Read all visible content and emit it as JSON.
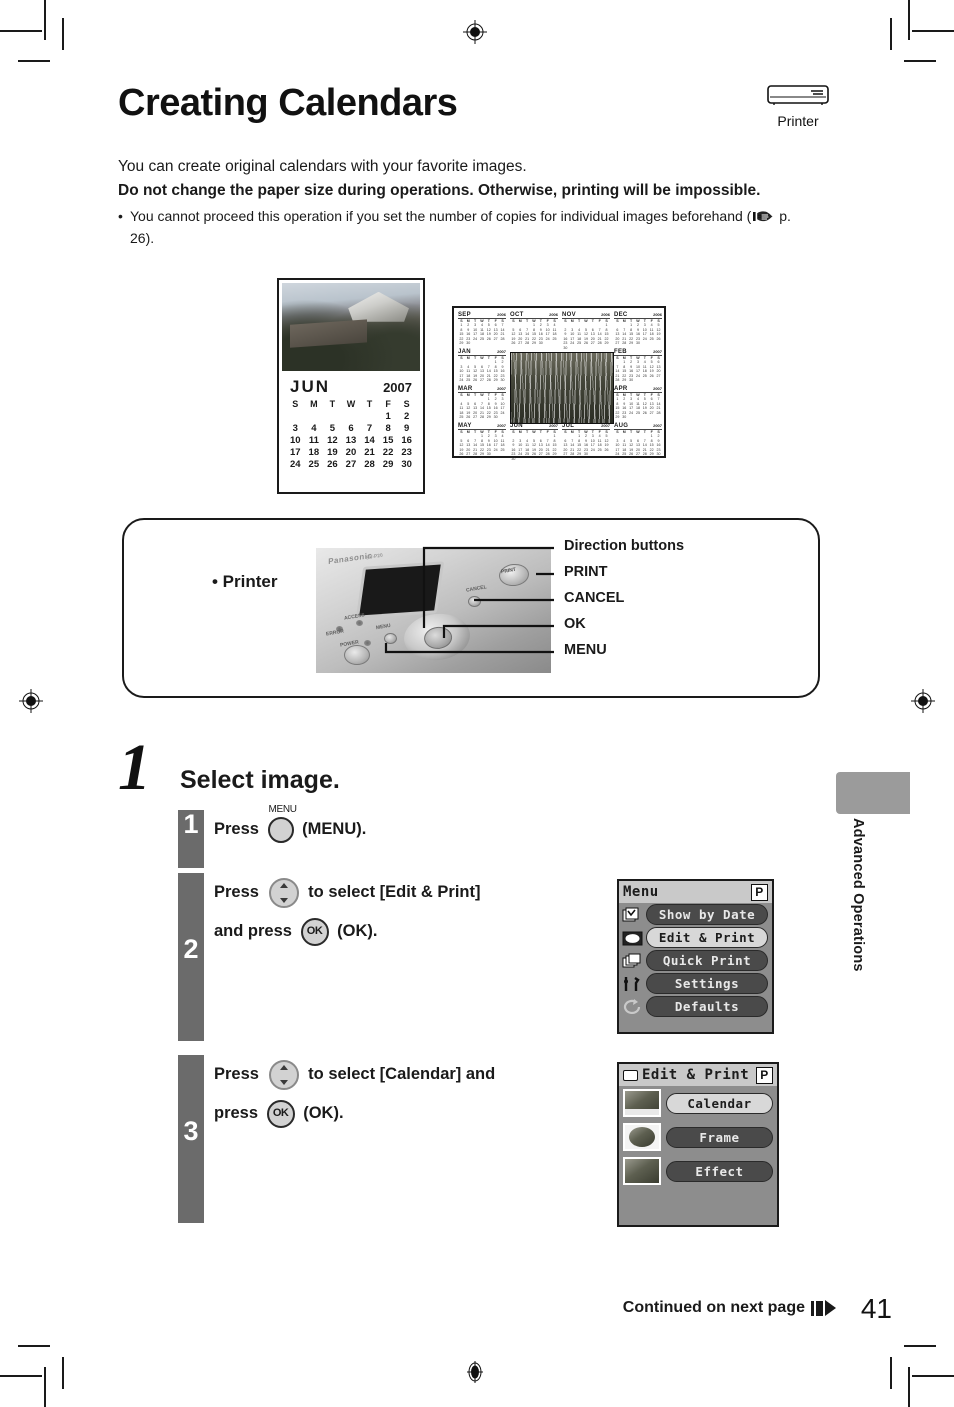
{
  "header": {
    "title": "Creating Calendars",
    "device_badge": {
      "icon": "printer-icon",
      "label": "Printer"
    }
  },
  "intro": {
    "line1": "You can create original calendars with your favorite images.",
    "warning": "Do not change the paper size during operations. Otherwise, printing will be impossible.",
    "bullet_mark": "•",
    "bullet_text_before": "You cannot proceed this operation if you set the number of copies for individual images beforehand (",
    "bullet_ref_icon": "pointing-hand-icon",
    "bullet_ref": " p. 26).",
    "bullet_text_after": ""
  },
  "samples": {
    "month_calendar": {
      "month": "JUN",
      "year": "2007",
      "dow": [
        "S",
        "M",
        "T",
        "W",
        "T",
        "F",
        "S"
      ],
      "weeks": [
        [
          "",
          "",
          "",
          "",
          "",
          "1",
          "2"
        ],
        [
          "3",
          "4",
          "5",
          "6",
          "7",
          "8",
          "9"
        ],
        [
          "10",
          "11",
          "12",
          "13",
          "14",
          "15",
          "16"
        ],
        [
          "17",
          "18",
          "19",
          "20",
          "21",
          "22",
          "23"
        ],
        [
          "24",
          "25",
          "26",
          "27",
          "28",
          "29",
          "30"
        ]
      ]
    },
    "year_calendar": {
      "months": [
        {
          "name": "SEP",
          "year": "2006"
        },
        {
          "name": "OCT",
          "year": "2006"
        },
        {
          "name": "NOV",
          "year": "2006"
        },
        {
          "name": "DEC",
          "year": "2006"
        },
        {
          "name": "JAN",
          "year": "2007"
        },
        {
          "name": "FEB",
          "year": "2007"
        },
        {
          "name": "MAR",
          "year": "2007"
        },
        {
          "name": "APR",
          "year": "2007"
        },
        {
          "name": "MAY",
          "year": "2007"
        },
        {
          "name": "JUN",
          "year": "2007"
        },
        {
          "name": "JUL",
          "year": "2007"
        },
        {
          "name": "AUG",
          "year": "2007"
        }
      ],
      "dow": [
        "S",
        "M",
        "T",
        "W",
        "T",
        "F",
        "S"
      ]
    }
  },
  "callout": {
    "device_label": "• Printer",
    "labels": [
      "Direction buttons",
      "PRINT",
      "CANCEL",
      "OK",
      "MENU"
    ],
    "panel": {
      "brand": "Panasonic",
      "model": "SV-P20",
      "btn_print": "PRINT",
      "btn_cancel": "CANCEL",
      "btn_menu": "MENU",
      "btn_ok": "OK",
      "led_error": "ERROR",
      "led_access": "ACCESS",
      "led_power": "POWER"
    }
  },
  "step": {
    "number": "1",
    "heading": "Select image.",
    "substeps": [
      {
        "num": "1",
        "text_parts": [
          "Press",
          "(MENU)."
        ],
        "button": "MENU",
        "button_cap": "MENU"
      },
      {
        "num": "2",
        "line1_before": "Press",
        "line1_after": "to select [Edit & Print]",
        "line2_before": "and press",
        "line2_after": "(OK).",
        "dpad": "direction-buttons",
        "ok": "OK"
      },
      {
        "num": "3",
        "line1_before": "Press",
        "line1_after": "to select [Calendar] and",
        "line2_before": "press",
        "line2_after": "(OK).",
        "dpad": "direction-buttons",
        "ok": "OK"
      }
    ]
  },
  "lcd_menu": {
    "title": "Menu",
    "badge": "P",
    "items": [
      {
        "icon": "show-by-date-icon",
        "label": "Show by Date",
        "selected": false
      },
      {
        "icon": "edit-print-icon",
        "label": "Edit & Print",
        "selected": true
      },
      {
        "icon": "quick-print-icon",
        "label": "Quick Print",
        "selected": false
      },
      {
        "icon": "settings-tools-icon",
        "label": "Settings",
        "selected": false
      },
      {
        "icon": "defaults-reset-icon",
        "label": "Defaults",
        "selected": false
      }
    ]
  },
  "lcd_edit_print": {
    "title": "Edit & Print",
    "title_icon": "screen-icon",
    "badge": "P",
    "items": [
      {
        "thumb": "calendar-thumb",
        "label": "Calendar",
        "selected": true
      },
      {
        "thumb": "frame-thumb",
        "label": "Frame",
        "selected": false
      },
      {
        "thumb": "effect-thumb",
        "label": "Effect",
        "selected": false
      }
    ]
  },
  "sidetab": {
    "label": "Advanced Operations"
  },
  "footer": {
    "continued": "Continued on next page",
    "continued_icon": "next-page-arrow-icon",
    "page_number": "41"
  }
}
